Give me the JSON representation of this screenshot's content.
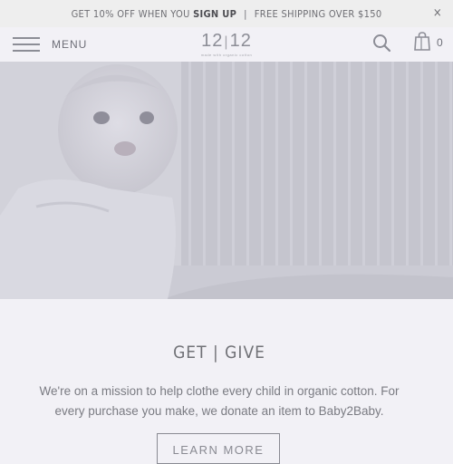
{
  "announcement": {
    "part1": "GET 10% OFF WHEN YOU ",
    "part1_strong": "SIGN UP",
    "separator": "|",
    "part2": "FREE SHIPPING OVER $150",
    "close_glyph": "×"
  },
  "header": {
    "menu_label": "MENU",
    "logo": {
      "left": "12",
      "bar": "|",
      "right": "12",
      "tagline": "made with organic cotton"
    },
    "cart_count": "0",
    "icons": [
      "hamburger-icon",
      "search-icon",
      "shopping-bag-icon",
      "close-icon"
    ]
  },
  "hero": {
    "description": "Baby lying on a white bed, photo"
  },
  "mission": {
    "title": "GET | GIVE",
    "text": "We're on a mission to help clothe every child in organic cotton. For every purchase you make, we donate an item to Baby2Baby.",
    "button_label": "LEARN MORE"
  },
  "colors": {
    "background": "#f2f1f6",
    "text": "#7a7b82",
    "accent": "#8c8d96"
  }
}
